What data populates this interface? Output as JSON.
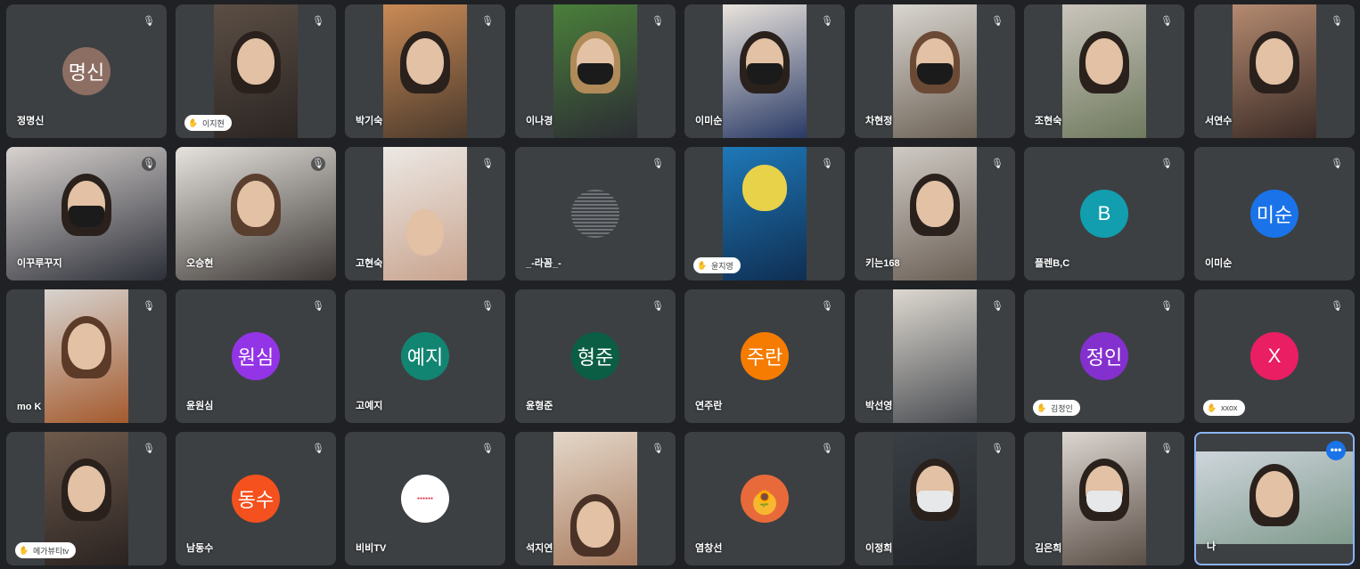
{
  "participants": [
    {
      "name": "정명신",
      "avatar": "명신",
      "avatar_color": "#8d6e63"
    },
    {
      "name": "이지현",
      "hand_raised": true
    },
    {
      "name": "박기숙"
    },
    {
      "name": "이나경"
    },
    {
      "name": "이미순"
    },
    {
      "name": "차현정"
    },
    {
      "name": "조현숙"
    },
    {
      "name": "서연수"
    },
    {
      "name": "이꾸루꾸지"
    },
    {
      "name": "오승현"
    },
    {
      "name": "고현숙"
    },
    {
      "name": "_-라꼼_-"
    },
    {
      "name": "윤지영",
      "hand_raised": true
    },
    {
      "name": "키는168"
    },
    {
      "name": "플렌B,C",
      "avatar": "B",
      "avatar_color": "#129eaf"
    },
    {
      "name": "이미순",
      "avatar": "미순",
      "avatar_color": "#1a73e8"
    },
    {
      "name": "mo K"
    },
    {
      "name": "윤원심",
      "avatar": "원심",
      "avatar_color": "#9334e6"
    },
    {
      "name": "고예지",
      "avatar": "예지",
      "avatar_color": "#128572"
    },
    {
      "name": "윤형준",
      "avatar": "형준",
      "avatar_color": "#0b5e43"
    },
    {
      "name": "연주란",
      "avatar": "주란",
      "avatar_color": "#f57c00"
    },
    {
      "name": "박선영"
    },
    {
      "name": "김정인",
      "hand_raised": true,
      "avatar": "정인",
      "avatar_color": "#8430ce"
    },
    {
      "name": "xxox",
      "hand_raised": true,
      "avatar": "X",
      "avatar_color": "#e91e63"
    },
    {
      "name": "메가뷰티tv",
      "hand_raised": true
    },
    {
      "name": "남동수",
      "avatar": "동수",
      "avatar_color": "#f4511e"
    },
    {
      "name": "비비TV"
    },
    {
      "name": "석지연"
    },
    {
      "name": "염창선"
    },
    {
      "name": "이정희"
    },
    {
      "name": "김은희"
    },
    {
      "name": "나",
      "is_self": true
    }
  ],
  "icons": {
    "mic_off": "mic-off-icon",
    "hand": "raised-hand-icon",
    "more": "more-options-icon"
  }
}
